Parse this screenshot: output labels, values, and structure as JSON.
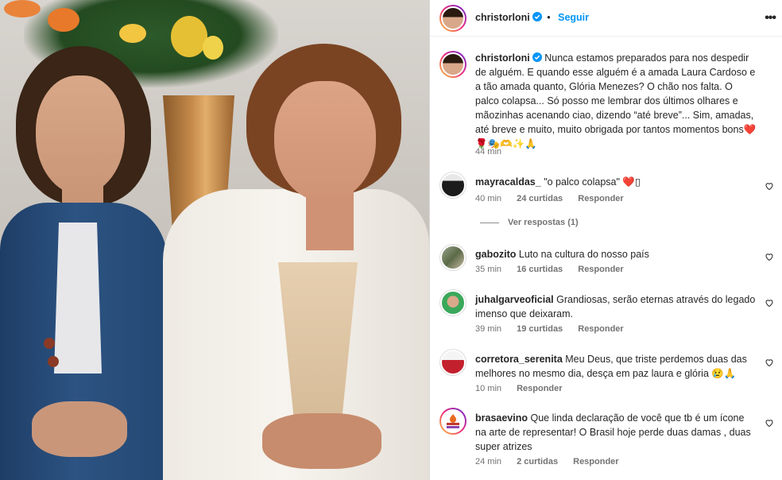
{
  "post": {
    "username": "christorloni",
    "follow_label": "Seguir",
    "more_label": "•••"
  },
  "caption": {
    "username": "christorloni",
    "text": "Nunca estamos preparados para nos despedir de alguém. E quando esse alguém é a amada Laura Cardoso e a tão amada quanto, Glória Menezes? O chão nos falta. O palco colapsa... Só posso me lembrar dos últimos olhares e mãozinhas acenando ciao, dizendo “até breve”... Sim, amadas, até breve e muito, muito obrigada por tantos momentos bons❤️🌹🎭🫶✨🙏",
    "time": "44 min"
  },
  "comments": [
    {
      "username": "mayracaldas_",
      "text": "\"o palco colapsa\" ❤️▯",
      "time": "40 min",
      "likes": "24 curtidas",
      "reply": "Responder"
    },
    {
      "username": "gabozito",
      "text": "Luto na cultura do nosso país",
      "time": "35 min",
      "likes": "16 curtidas",
      "reply": "Responder"
    },
    {
      "username": "juhalgarveoficial",
      "text": "Grandiosas, serão eternas através do legado imenso que deixaram.",
      "time": "39 min",
      "likes": "19 curtidas",
      "reply": "Responder"
    },
    {
      "username": "corretora_serenita",
      "text": "Meu Deus, que triste perdemos duas das melhores no mesmo dia, desça em paz laura e glória 😢🙏",
      "time": "10 min",
      "likes": "",
      "reply": "Responder"
    },
    {
      "username": "brasaevino",
      "text": "Que linda declaração de você que tb é um ícone na arte de representar! O Brasil hoje perde duas damas , duas super atrizes",
      "time": "24 min",
      "likes": "2 curtidas",
      "reply": "Responder"
    }
  ],
  "view_replies": "Ver respostas (1)",
  "colors": {
    "link": "#0095f6",
    "meta": "#737373",
    "text": "#262626"
  }
}
